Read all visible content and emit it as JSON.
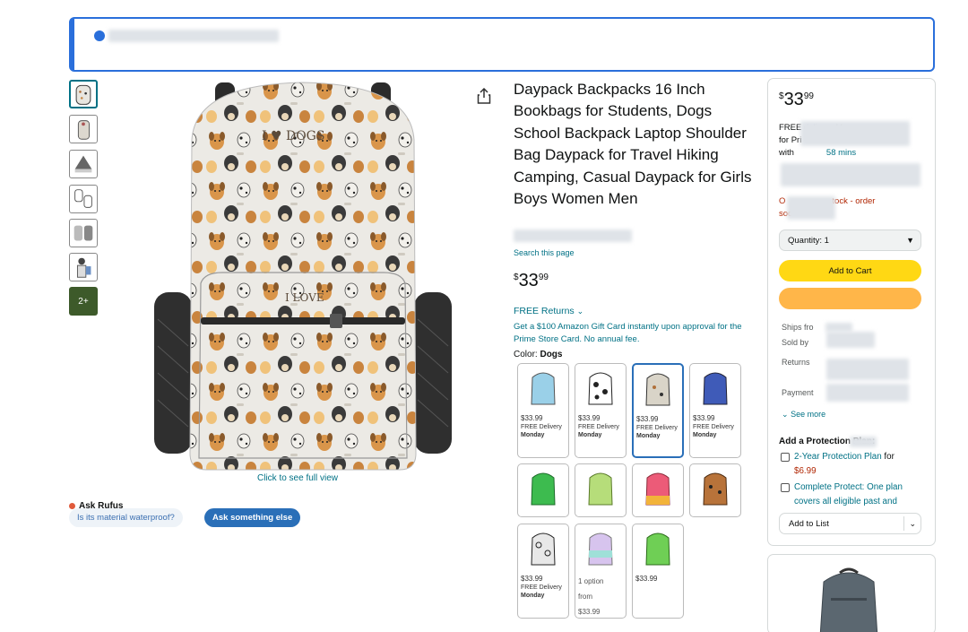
{
  "product": {
    "title": "Daypack Backpacks 16 Inch Bookbags for Students, Dogs School Backpack Laptop Shoulder Bag Daypack for Travel Hiking Camping, Casual Daypack for Girls Boys Women Men",
    "search_page": "Search this page",
    "price_symbol": "$",
    "price_whole": "33",
    "price_cents": "99",
    "free_returns": "FREE Returns",
    "gift_card": "Get a $100 Amazon Gift Card instantly upon approval for the Prime Store Card. No annual fee.",
    "color_label": "Color:",
    "color_value": "Dogs"
  },
  "gallery": {
    "more_label": "2+",
    "click_full": "Click to see full view"
  },
  "rufus": {
    "title": "Ask Rufus",
    "question": "Is its material waterproof?",
    "ask_button": "Ask something else"
  },
  "swatches": [
    {
      "color": "#9ad0e8",
      "price": "$33.99",
      "delivery": "FREE Delivery",
      "day": "Monday"
    },
    {
      "color": "#ffffff",
      "price": "$33.99",
      "delivery": "FREE Delivery",
      "day": "Monday"
    },
    {
      "color": "#d9d4c8",
      "price": "$33.99",
      "delivery": "FREE Delivery",
      "day": "Monday"
    },
    {
      "color": "#3f5bb8",
      "price": "$33.99",
      "delivery": "FREE Delivery",
      "day": "Monday"
    },
    {
      "color": "#3dbb4f"
    },
    {
      "color": "#b6dd7a"
    },
    {
      "color": "#ec5b78"
    },
    {
      "color": "#b8733a"
    },
    {
      "color": "#e8e8e8",
      "price": "$33.99",
      "delivery": "FREE Delivery",
      "day": "Monday"
    },
    {
      "color": "#d7c4ee",
      "option": "1 option",
      "from": "from",
      "price": "$33.99"
    },
    {
      "color": "#6fcf55",
      "price": "$33.99"
    }
  ],
  "buybox": {
    "price_symbol": "$",
    "price_whole": "33",
    "price_cents": "99",
    "delivery_line1": "FREE delivery Mo",
    "delivery_line2": "for Pri",
    "delivery_line3": "with",
    "delivery_mins": "58 mins",
    "stock_line1": "O",
    "stock_line1b": "tock - order",
    "stock_line2": "soo",
    "quantity_label": "Quantity: 1",
    "add_to_cart": "Add to Cart",
    "ships_from": "Ships fro",
    "sold_by": "Sold by",
    "returns": "Returns",
    "payment": "Payment",
    "see_more": "See more",
    "protection_title": "Add a Protection Plan:",
    "plan1_link": "2-Year Protection Plan",
    "plan1_for": "for",
    "plan1_price": "$6.99",
    "plan2_link": "Complete Protect: One plan covers all eligible past and",
    "add_to_list": "Add to List"
  }
}
